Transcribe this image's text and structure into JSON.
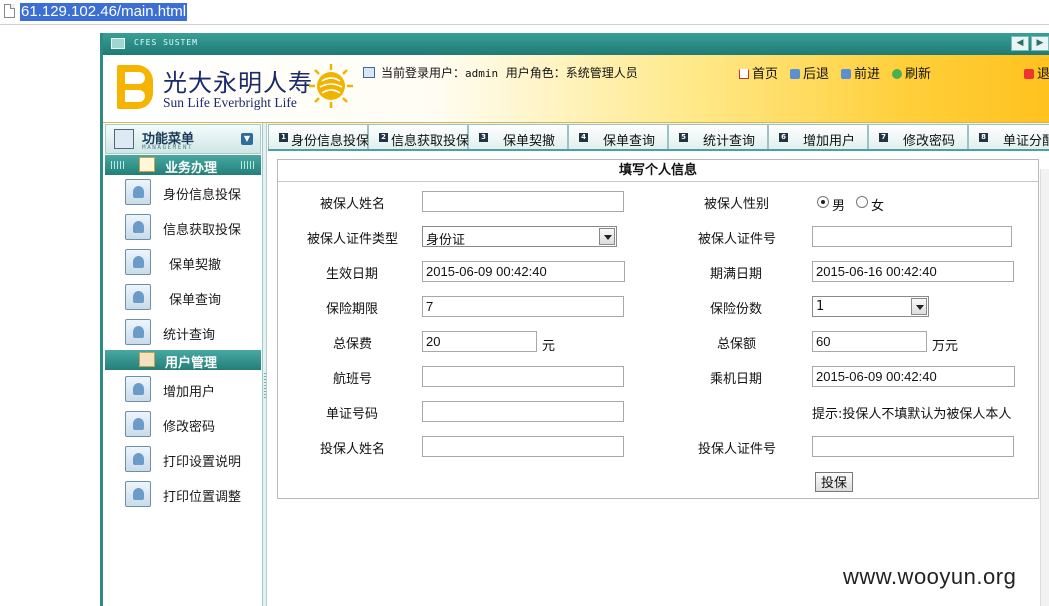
{
  "browser": {
    "url": "61.129.102.46/main.html"
  },
  "window": {
    "system_title": "CFES SUSTEM"
  },
  "header": {
    "brand_cn": "光大永明人寿",
    "brand_en": "Sun Life Everbright Life",
    "current_user_label": "当前登录用户：",
    "current_user": "admin",
    "role_label": "用户角色：",
    "role": "系统管理人员",
    "links": {
      "home": "首页",
      "back": "后退",
      "forward": "前进",
      "refresh": "刷新",
      "logout": "退"
    }
  },
  "sidebar": {
    "title": "功能菜单",
    "subtitle": "MANAGEMENT",
    "groups": [
      {
        "label": "业务办理",
        "items": [
          "身份信息投保",
          "信息获取投保",
          "保单契撤",
          "保单查询",
          "统计查询"
        ]
      },
      {
        "label": "用户管理",
        "items": [
          "增加用户",
          "修改密码",
          "打印设置说明",
          "打印位置调整"
        ]
      }
    ]
  },
  "tabs": [
    {
      "num": "1",
      "label": "身份信息投保"
    },
    {
      "num": "2",
      "label": "信息获取投保"
    },
    {
      "num": "3",
      "label": "保单契撤"
    },
    {
      "num": "4",
      "label": "保单查询"
    },
    {
      "num": "5",
      "label": "统计查询"
    },
    {
      "num": "6",
      "label": "增加用户"
    },
    {
      "num": "7",
      "label": "修改密码"
    },
    {
      "num": "8",
      "label": "单证分配"
    }
  ],
  "form": {
    "title": "填写个人信息",
    "insured_name_label": "被保人姓名",
    "insured_name": "",
    "gender_label": "被保人性别",
    "gender_male": "男",
    "gender_female": "女",
    "gender_selected": "male",
    "id_type_label": "被保人证件类型",
    "id_type": "身份证",
    "id_no_label": "被保人证件号",
    "id_no": "",
    "effective_date_label": "生效日期",
    "effective_date": "2015-06-09 00:42:40",
    "expiry_date_label": "期满日期",
    "expiry_date": "2015-06-16 00:42:40",
    "term_label": "保险期限",
    "term": "7",
    "copies_label": "保险份数",
    "copies": "1",
    "premium_label": "总保费",
    "premium": "20",
    "premium_unit": "元",
    "coverage_label": "总保额",
    "coverage": "60",
    "coverage_unit": "万元",
    "flight_label": "航班号",
    "flight": "",
    "boarding_date_label": "乘机日期",
    "boarding_date": "2015-06-09 00:42:40",
    "voucher_label": "单证号码",
    "voucher": "",
    "hint": "提示:投保人不填默认为被保人本人",
    "applicant_name_label": "投保人姓名",
    "applicant_name": "",
    "applicant_id_label": "投保人证件号",
    "applicant_id": "",
    "submit": "投保"
  },
  "watermark": "www.wooyun.org"
}
